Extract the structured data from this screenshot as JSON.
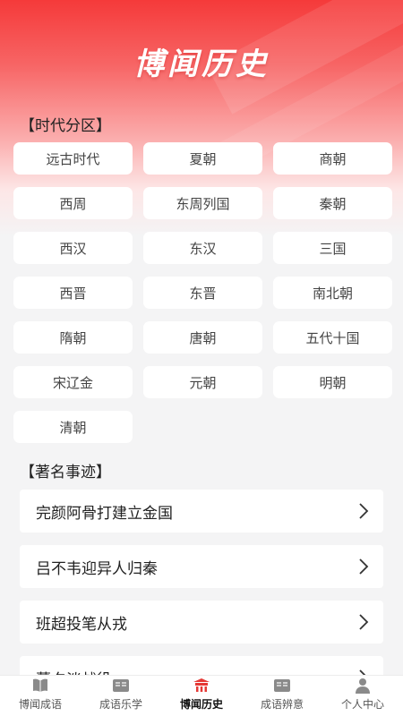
{
  "header": {
    "title": "博闻历史"
  },
  "era_section": {
    "title": "【时代分区】",
    "items": [
      "远古时代",
      "夏朝",
      "商朝",
      "西周",
      "东周列国",
      "秦朝",
      "西汉",
      "东汉",
      "三国",
      "西晋",
      "东晋",
      "南北朝",
      "隋朝",
      "唐朝",
      "五代十国",
      "宋辽金",
      "元朝",
      "明朝",
      "清朝"
    ]
  },
  "events_section": {
    "title": "【著名事迹】",
    "items": [
      "完颜阿骨打建立金国",
      "吕不韦迎异人归秦",
      "班超投笔从戎",
      "藿夕淡战役"
    ]
  },
  "tabbar": {
    "items": [
      {
        "label": "博闻成语",
        "icon": "book-icon"
      },
      {
        "label": "成语乐学",
        "icon": "card-icon"
      },
      {
        "label": "博闻历史",
        "icon": "history-icon"
      },
      {
        "label": "成语辨意",
        "icon": "card-icon"
      },
      {
        "label": "个人中心",
        "icon": "person-icon"
      }
    ],
    "active_index": 2
  },
  "colors": {
    "accent": "#f53a3a",
    "card": "#ffffff",
    "background": "#f4f4f5"
  }
}
